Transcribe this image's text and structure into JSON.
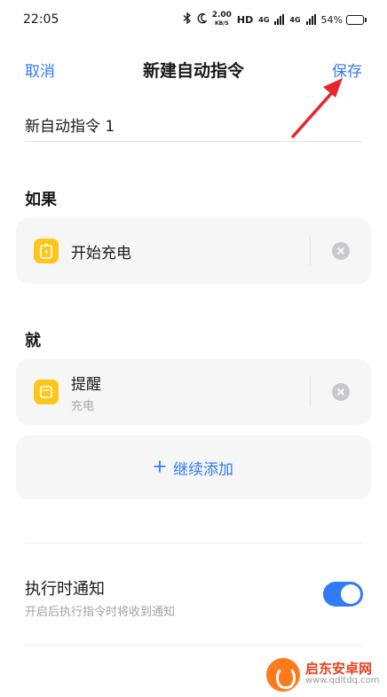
{
  "status_bar": {
    "time": "22:05",
    "speed_value": "2.00",
    "speed_unit": "KB/S",
    "hd": "HD",
    "net1": "4G",
    "net2": "4G",
    "battery": "54%",
    "battery_level": 0.54
  },
  "header": {
    "cancel_label": "取消",
    "title": "新建自动指令",
    "save_label": "保存"
  },
  "name_field": {
    "value": "新自动指令 1"
  },
  "if_section": {
    "label": "如果",
    "item": {
      "title": "开始充电"
    }
  },
  "then_section": {
    "label": "就",
    "item": {
      "title": "提醒",
      "subtitle": "充电"
    },
    "add_label": "继续添加"
  },
  "notify": {
    "title": "执行时通知",
    "description": "开启后执行指令时将收到通知",
    "enabled": true
  },
  "watermark": {
    "name": "启东安卓网",
    "url": "www.qdltdq.com"
  },
  "colors": {
    "accent": "#2f7cf6",
    "icon_bg": "#ffc61a",
    "arrow": "#e5262a"
  }
}
